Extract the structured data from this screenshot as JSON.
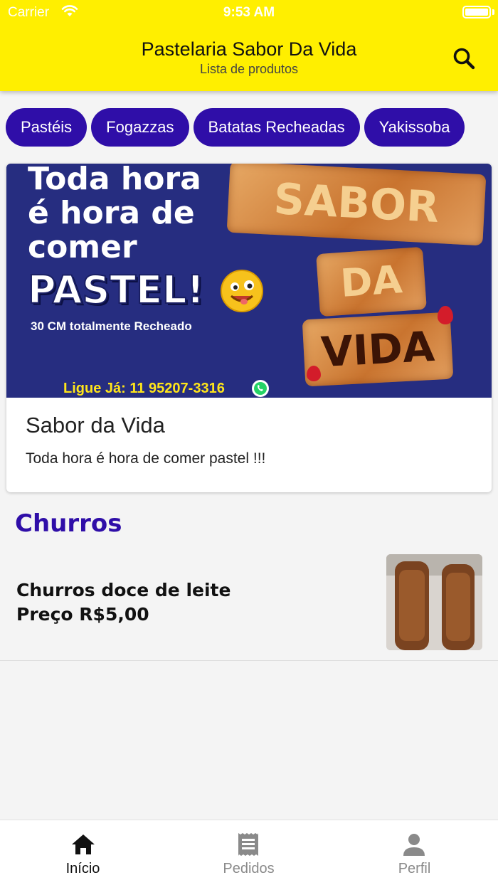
{
  "status_bar": {
    "carrier": "Carrier",
    "time": "9:53 AM"
  },
  "header": {
    "title": "Pastelaria Sabor Da Vida",
    "subtitle": "Lista de produtos",
    "search_icon": "search-icon"
  },
  "categories": [
    {
      "label": "Pastéis"
    },
    {
      "label": "Fogazzas"
    },
    {
      "label": "Batatas Recheadas"
    },
    {
      "label": "Yakissoba"
    }
  ],
  "promo": {
    "image": {
      "headline_line1": "Toda hora",
      "headline_line2": "é hora de",
      "headline_line3": "comer",
      "headline_big": "PASTEL!",
      "subline": "30 CM totalmente Recheado",
      "phone": "Ligue Já: 11 95207-3316",
      "pastry_words": [
        "SABOR",
        "DA",
        "VIDA"
      ]
    },
    "title": "Sabor da Vida",
    "description": "Toda hora é hora de comer pastel !!!"
  },
  "section": {
    "title": "Churros"
  },
  "products": [
    {
      "name": "Churros doce de leite",
      "price": "Preço R$5,00",
      "image_alt": "churros with colored candies"
    }
  ],
  "tabbar": {
    "active": "Início",
    "items": [
      {
        "label": "Início",
        "icon": "home-icon"
      },
      {
        "label": "Pedidos",
        "icon": "receipt-icon"
      },
      {
        "label": "Perfil",
        "icon": "person-icon"
      }
    ]
  },
  "colors": {
    "header_bg": "#ffef00",
    "accent": "#2f0ea8",
    "banner_bg": "#262d80",
    "background": "#f4f4f4"
  }
}
